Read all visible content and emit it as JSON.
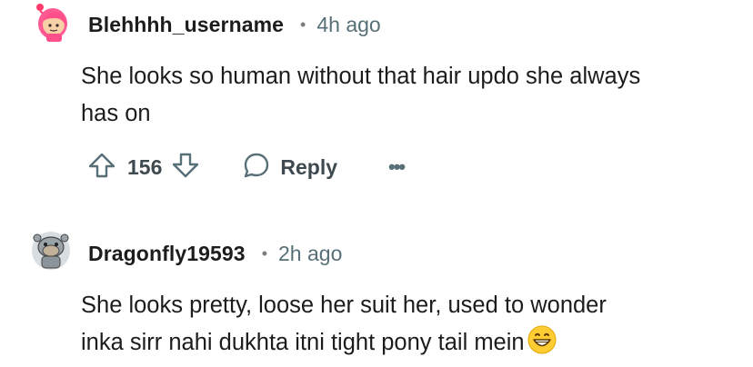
{
  "comments": [
    {
      "username": "Blehhhh_username",
      "separator": "•",
      "time": "4h ago",
      "text_lines": [
        "She looks so human without that hair updo she always",
        "has on"
      ],
      "votes": "156",
      "reply_label": "Reply",
      "more_label": "•••",
      "avatar_icon": "pink-snoo-avatar-icon"
    },
    {
      "username": "Dragonfly19593",
      "separator": "•",
      "time": "2h ago",
      "text_lines": [
        "She looks pretty, loose her suit her, used to wonder",
        "inka sirr nahi dukhta itni tight pony tail mein"
      ],
      "emoji": "grinning-face-emoji-icon",
      "avatar_icon": "grey-snoo-avatar-icon"
    }
  ],
  "colors": {
    "text": "#1c1c1c",
    "meta": "#576f76",
    "pink": "#ff4f8b",
    "emoji_yellow": "#ffcc33"
  }
}
